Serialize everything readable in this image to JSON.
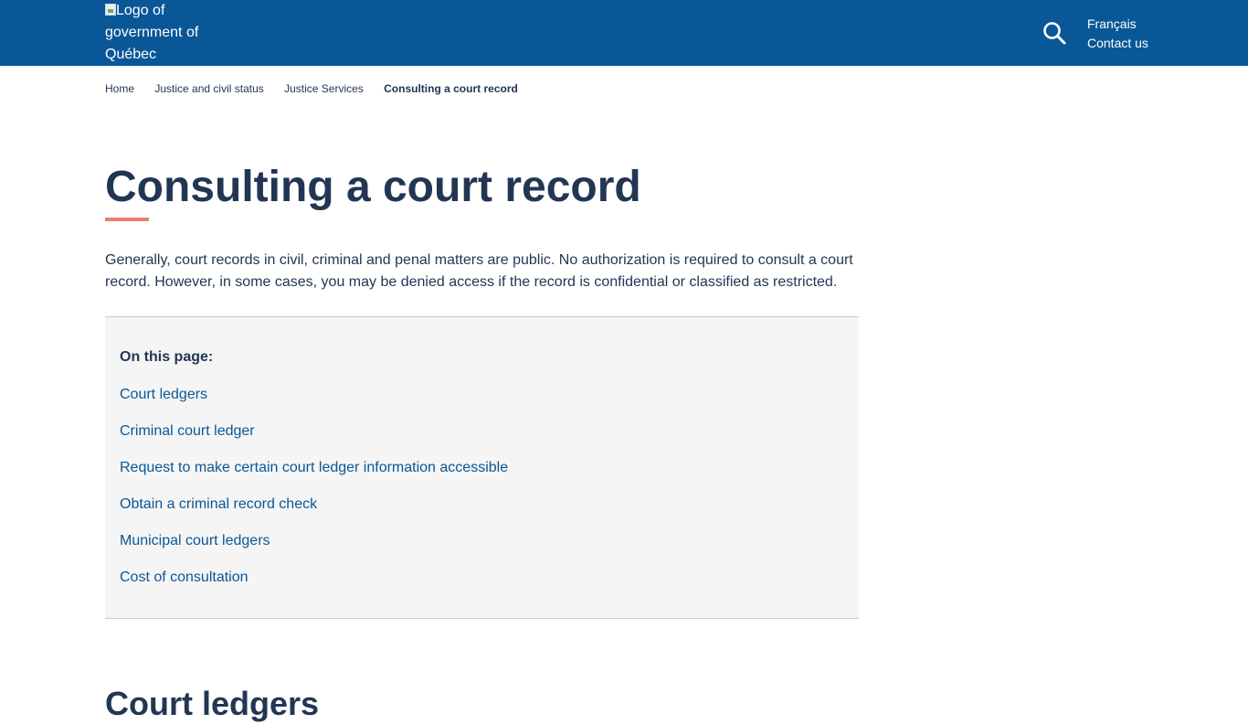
{
  "header": {
    "logo_alt": "Logo of government of Québec",
    "logo_lines": [
      "Logo of",
      "government of",
      "Québec"
    ],
    "search_icon": "search-icon",
    "links": [
      "Français",
      "Contact us"
    ]
  },
  "breadcrumb": {
    "items": [
      "Home",
      "Justice and civil status",
      "Justice Services"
    ],
    "current": "Consulting a court record"
  },
  "page": {
    "title": "Consulting a court record",
    "intro": "Generally, court records in civil, criminal and penal matters are public. No authorization is required to consult a court record. However, in some cases, you may be denied access if the record is confidential or classified as restricted."
  },
  "toc": {
    "title": "On this page:",
    "links": [
      "Court ledgers",
      "Criminal court ledger",
      "Request to make certain court ledger information accessible",
      "Obtain a criminal record check",
      "Municipal court ledgers",
      "Cost of consultation"
    ]
  },
  "section": {
    "heading": "Court ledgers"
  },
  "colors": {
    "header_bg": "#095797",
    "text": "#223654",
    "link": "#095797",
    "accent_rule": "#e58271",
    "toc_bg": "#f5f5f5"
  }
}
